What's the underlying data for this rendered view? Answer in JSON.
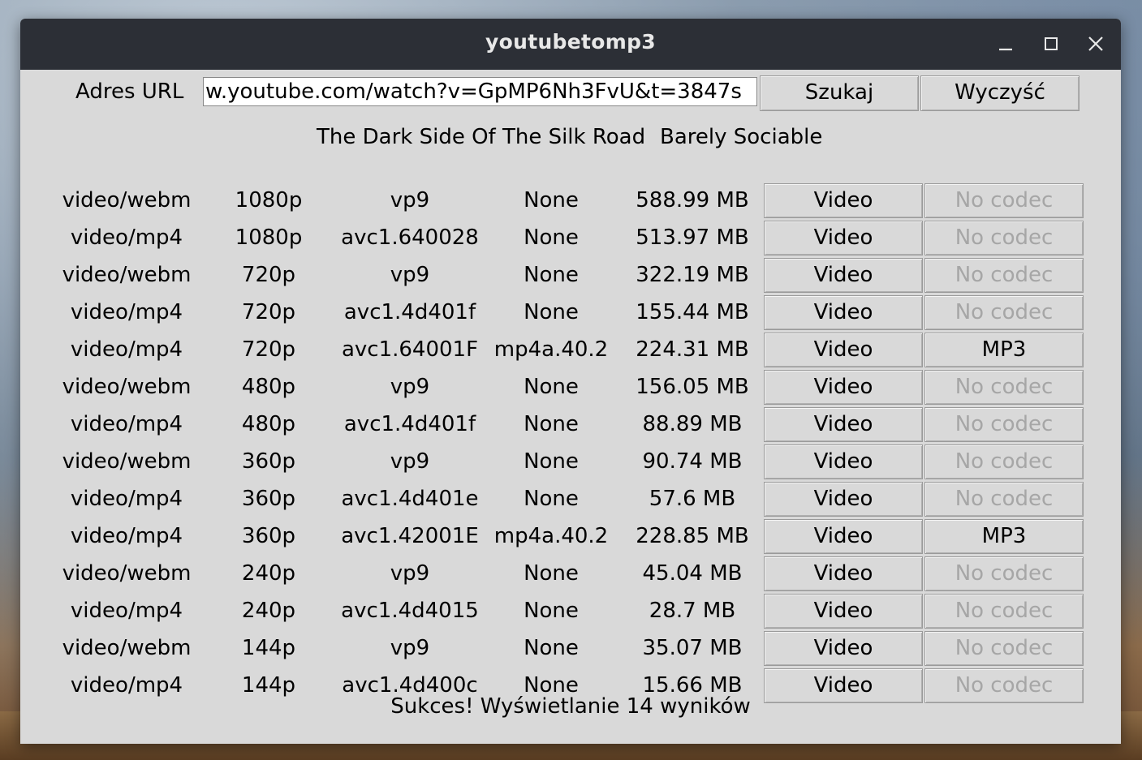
{
  "window": {
    "title": "youtubetomp3"
  },
  "colors": {
    "titlebar": "#2c2f36",
    "window_bg": "#d9d9d9",
    "disabled_text": "#a6a6a6"
  },
  "search": {
    "label": "Adres URL",
    "url_value": "w.youtube.com/watch?v=GpMP6Nh3FvU&t=3847s",
    "search_button": "Szukaj",
    "clear_button": "Wyczyść"
  },
  "video": {
    "title": "The Dark Side Of The Silk Road",
    "author": "Barely Sociable"
  },
  "streams": [
    {
      "type": "video/webm",
      "res": "1080p",
      "vcodec": "vp9",
      "acodec": "None",
      "size": "588.99 MB",
      "video_btn": "Video",
      "audio_btn": "No codec",
      "audio_enabled": false
    },
    {
      "type": "video/mp4",
      "res": "1080p",
      "vcodec": "avc1.640028",
      "acodec": "None",
      "size": "513.97 MB",
      "video_btn": "Video",
      "audio_btn": "No codec",
      "audio_enabled": false
    },
    {
      "type": "video/webm",
      "res": "720p",
      "vcodec": "vp9",
      "acodec": "None",
      "size": "322.19 MB",
      "video_btn": "Video",
      "audio_btn": "No codec",
      "audio_enabled": false
    },
    {
      "type": "video/mp4",
      "res": "720p",
      "vcodec": "avc1.4d401f",
      "acodec": "None",
      "size": "155.44 MB",
      "video_btn": "Video",
      "audio_btn": "No codec",
      "audio_enabled": false
    },
    {
      "type": "video/mp4",
      "res": "720p",
      "vcodec": "avc1.64001F",
      "acodec": "mp4a.40.2",
      "size": "224.31 MB",
      "video_btn": "Video",
      "audio_btn": "MP3",
      "audio_enabled": true
    },
    {
      "type": "video/webm",
      "res": "480p",
      "vcodec": "vp9",
      "acodec": "None",
      "size": "156.05 MB",
      "video_btn": "Video",
      "audio_btn": "No codec",
      "audio_enabled": false
    },
    {
      "type": "video/mp4",
      "res": "480p",
      "vcodec": "avc1.4d401f",
      "acodec": "None",
      "size": "88.89 MB",
      "video_btn": "Video",
      "audio_btn": "No codec",
      "audio_enabled": false
    },
    {
      "type": "video/webm",
      "res": "360p",
      "vcodec": "vp9",
      "acodec": "None",
      "size": "90.74 MB",
      "video_btn": "Video",
      "audio_btn": "No codec",
      "audio_enabled": false
    },
    {
      "type": "video/mp4",
      "res": "360p",
      "vcodec": "avc1.4d401e",
      "acodec": "None",
      "size": "57.6 MB",
      "video_btn": "Video",
      "audio_btn": "No codec",
      "audio_enabled": false
    },
    {
      "type": "video/mp4",
      "res": "360p",
      "vcodec": "avc1.42001E",
      "acodec": "mp4a.40.2",
      "size": "228.85 MB",
      "video_btn": "Video",
      "audio_btn": "MP3",
      "audio_enabled": true
    },
    {
      "type": "video/webm",
      "res": "240p",
      "vcodec": "vp9",
      "acodec": "None",
      "size": "45.04 MB",
      "video_btn": "Video",
      "audio_btn": "No codec",
      "audio_enabled": false
    },
    {
      "type": "video/mp4",
      "res": "240p",
      "vcodec": "avc1.4d4015",
      "acodec": "None",
      "size": "28.7 MB",
      "video_btn": "Video",
      "audio_btn": "No codec",
      "audio_enabled": false
    },
    {
      "type": "video/webm",
      "res": "144p",
      "vcodec": "vp9",
      "acodec": "None",
      "size": "35.07 MB",
      "video_btn": "Video",
      "audio_btn": "No codec",
      "audio_enabled": false
    },
    {
      "type": "video/mp4",
      "res": "144p",
      "vcodec": "avc1.4d400c",
      "acodec": "None",
      "size": "15.66 MB",
      "video_btn": "Video",
      "audio_btn": "No codec",
      "audio_enabled": false
    }
  ],
  "status": {
    "message": "Sukces! Wyświetlanie 14 wyników"
  }
}
